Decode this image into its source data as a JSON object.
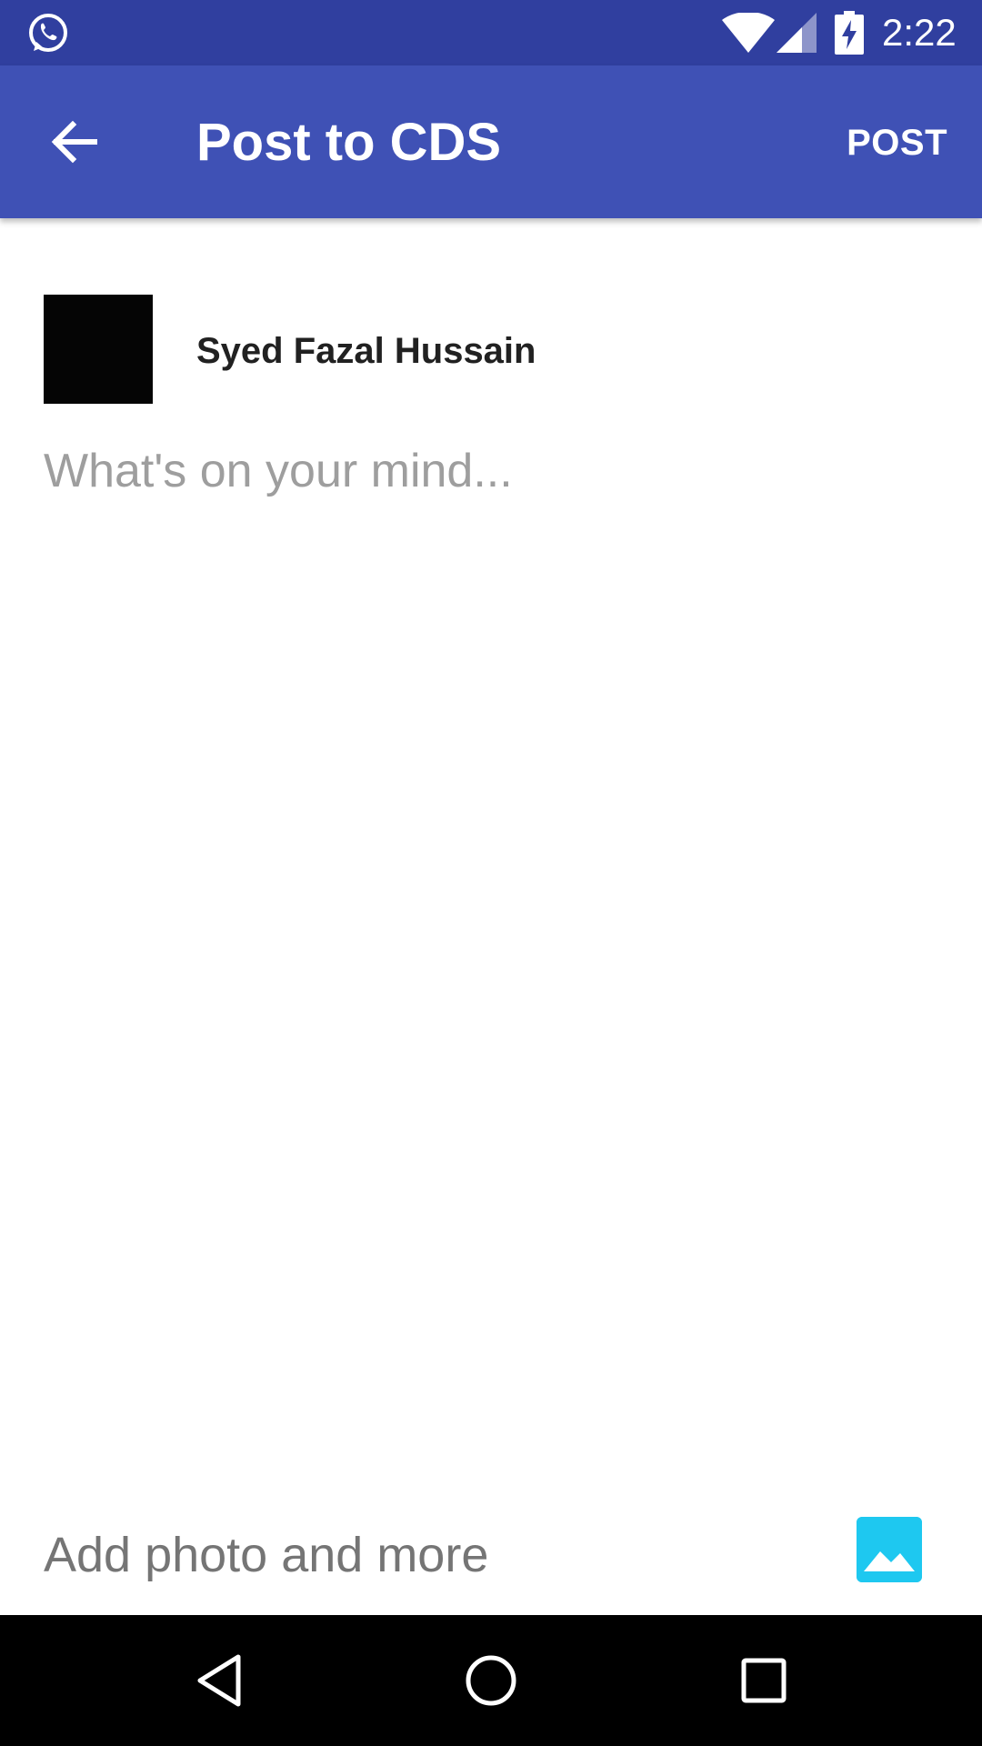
{
  "status_bar": {
    "time": "2:22",
    "notification_icon": "whatsapp-icon",
    "wifi_icon": "wifi-icon",
    "signal_icon": "cell-signal-icon",
    "battery_icon": "battery-charging-icon"
  },
  "app_bar": {
    "back_icon": "arrow-back-icon",
    "title": "Post to CDS",
    "post_label": "POST"
  },
  "author": {
    "name": "Syed Fazal Hussain"
  },
  "composer": {
    "placeholder": "What's on your mind...",
    "value": ""
  },
  "attachments": {
    "label": "Add photo and more",
    "icon": "photo-icon"
  },
  "nav_bar": {
    "back_icon": "nav-back-icon",
    "home_icon": "nav-home-icon",
    "recents_icon": "nav-recents-icon"
  },
  "colors": {
    "status_bar": "#303f9f",
    "app_bar": "#3f51b5",
    "photo_button": "#1ec8f0",
    "placeholder": "#9e9e9e",
    "secondary_text": "#757575"
  }
}
